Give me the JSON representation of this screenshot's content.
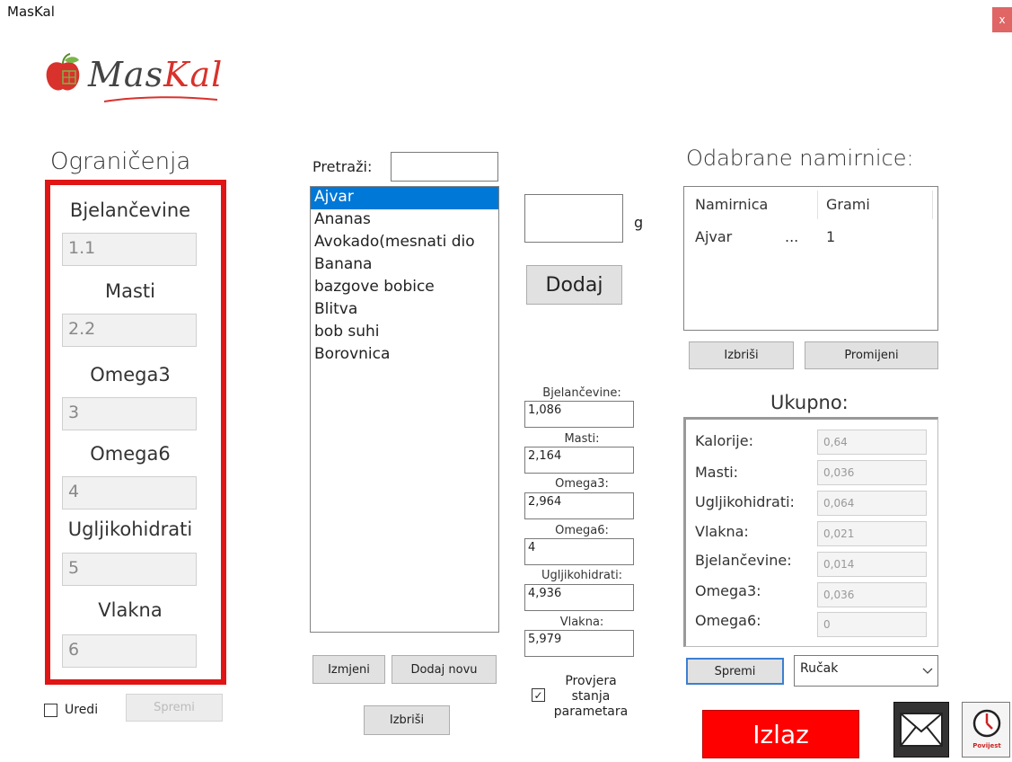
{
  "window": {
    "title": "MasKal",
    "close_label": "x"
  },
  "logo": {
    "prefix": "Mas",
    "accent": "Kal"
  },
  "limits": {
    "heading": "Ograničenja",
    "items": [
      {
        "label": "Bjelančevine",
        "value": "1.1"
      },
      {
        "label": "Masti",
        "value": "2.2"
      },
      {
        "label": "Omega3",
        "value": "3"
      },
      {
        "label": "Omega6",
        "value": "4"
      },
      {
        "label": "Ugljikohidrati",
        "value": "5"
      },
      {
        "label": "Vlakna",
        "value": "6"
      }
    ],
    "edit_label": "Uredi",
    "save_label": "Spremi"
  },
  "search": {
    "label": "Pretraži:",
    "value": "",
    "items": [
      "Ajvar",
      "Ananas",
      "Avokado(mesnati dio",
      "Banana",
      "bazgove bobice",
      "Blitva",
      "bob suhi",
      "Borovnica"
    ],
    "selected_index": 0,
    "edit_label": "Izmjeni",
    "add_new_label": "Dodaj novu",
    "delete_label": "Izbriši"
  },
  "amount": {
    "value": "",
    "unit": "g",
    "add_label": "Dodaj"
  },
  "params": [
    {
      "label": "Bjelančevine:",
      "value": "1,086"
    },
    {
      "label": "Masti:",
      "value": "2,164"
    },
    {
      "label": "Omega3:",
      "value": "2,964"
    },
    {
      "label": "Omega6:",
      "value": "4"
    },
    {
      "label": "Ugljikohidrati:",
      "value": "4,936"
    },
    {
      "label": "Vlakna:",
      "value": "5,979"
    }
  ],
  "check_params": {
    "label_line1": "Provjera",
    "label_line2": "stanja",
    "label_line3": "parametara",
    "checked": true,
    "mark": "✓"
  },
  "selected": {
    "heading": "Odabrane namirnice:",
    "columns": [
      "Namirnica",
      "Grami"
    ],
    "rows": [
      {
        "name": "Ajvar",
        "ellipsis": "...",
        "grams": "1"
      }
    ],
    "delete_label": "Izbriši",
    "change_label": "Promijeni"
  },
  "totals": {
    "heading": "Ukupno:",
    "items": [
      {
        "label": "Kalorije:",
        "value": "0,64"
      },
      {
        "label": "Masti:",
        "value": "0,036"
      },
      {
        "label": "Ugljikohidrati:",
        "value": "0,064"
      },
      {
        "label": "Vlakna:",
        "value": "0,021"
      },
      {
        "label": "Bjelančevine:",
        "value": "0,014"
      },
      {
        "label": "Omega3:",
        "value": "0,036"
      },
      {
        "label": "Omega6:",
        "value": "0"
      }
    ]
  },
  "bottom": {
    "save_label": "Spremi",
    "meal_value": "Ručak",
    "exit_label": "Izlaz",
    "history_label": "Povijest"
  },
  "colors": {
    "accent_red": "#e01515",
    "selection_blue": "#0078d7",
    "exit_red": "#ff0000"
  }
}
